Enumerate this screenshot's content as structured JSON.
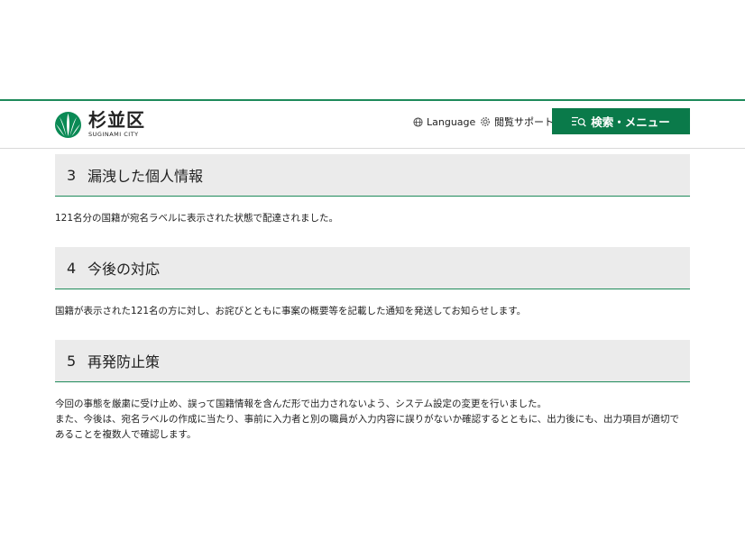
{
  "header": {
    "logo_name": "杉並区",
    "logo_sub": "SUGINAMI CITY",
    "language_label": "Language",
    "support_label": "閲覧サポート",
    "menu_label": "検索・メニュー",
    "brand_color": "#0a7a4a"
  },
  "sections": [
    {
      "number": "3",
      "title": "漏洩した個人情報",
      "body": [
        "121名分の国籍が宛名ラベルに表示された状態で配達されました。"
      ]
    },
    {
      "number": "4",
      "title": "今後の対応",
      "body": [
        "国籍が表示された121名の方に対し、お詫びとともに事案の概要等を記載した通知を発送してお知らせします。"
      ]
    },
    {
      "number": "5",
      "title": "再発防止策",
      "body": [
        "今回の事態を厳粛に受け止め、誤って国籍情報を含んだ形で出力されないよう、システム設定の変更を行いました。",
        "また、今後は、宛名ラベルの作成に当たり、事前に入力者と別の職員が入力内容に誤りがないか確認するとともに、出力後にも、出力項目が適切で",
        "あることを複数人で確認します。"
      ]
    }
  ]
}
